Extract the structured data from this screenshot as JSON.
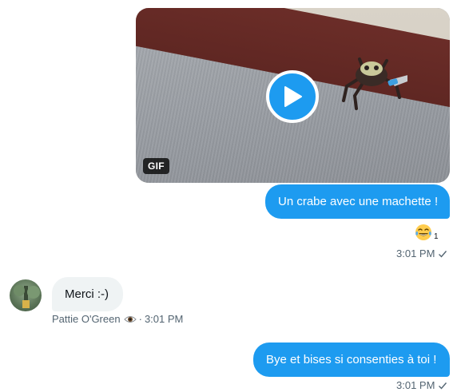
{
  "messages": {
    "gif": {
      "badge": "GIF",
      "caption": "Un crabe avec une machette !",
      "reaction_count": "1",
      "time": "3:01 PM"
    },
    "incoming": {
      "text": "Merci :-)",
      "sender": "Pattie O'Green",
      "separator": "·",
      "time": "3:01 PM"
    },
    "outgoing_last": {
      "text": "Bye et bises si consenties à toi !",
      "time": "3:01 PM"
    }
  },
  "colors": {
    "accent": "#1d9bf0",
    "incoming_bubble": "#eff3f4",
    "meta_text": "#536471"
  },
  "icons": {
    "play": "play-icon",
    "reaction": "laughing-emoji-icon",
    "seen": "checkmark-icon",
    "eye": "eye-emoji-icon"
  }
}
